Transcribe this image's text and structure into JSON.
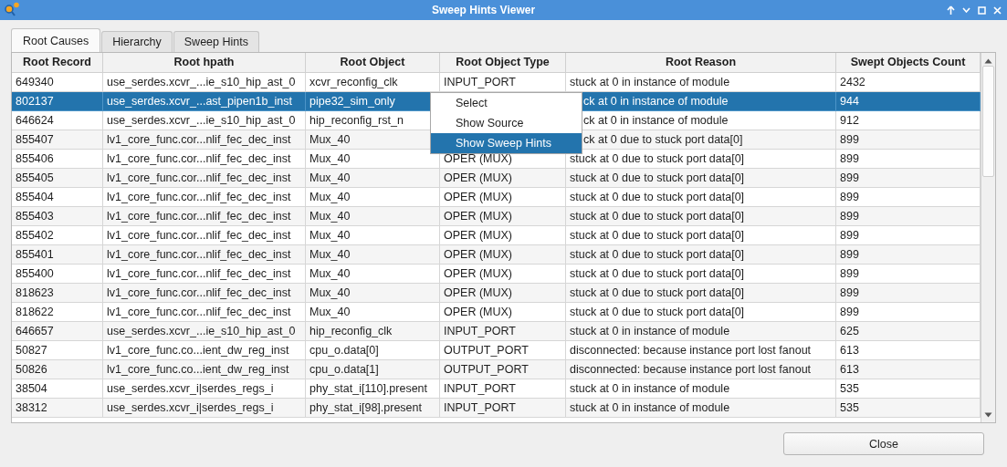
{
  "window": {
    "title": "Sweep Hints Viewer"
  },
  "tabs": [
    {
      "label": "Root Causes",
      "selected": true
    },
    {
      "label": "Hierarchy",
      "selected": false
    },
    {
      "label": "Sweep Hints",
      "selected": false
    }
  ],
  "table": {
    "columns": [
      "Root Record",
      "Root hpath",
      "Root Object",
      "Root Object Type",
      "Root Reason",
      "Swept Objects Count"
    ],
    "rows": [
      {
        "selected": false,
        "cells": [
          "649340",
          "use_serdes.xcvr_...ie_s10_hip_ast_0",
          "xcvr_reconfig_clk",
          "INPUT_PORT",
          "stuck at 0 in instance of module",
          "2432"
        ]
      },
      {
        "selected": true,
        "cells": [
          "802137",
          "use_serdes.xcvr_...ast_pipen1b_inst",
          "pipe32_sim_only",
          null,
          "ck at 0 in instance of module",
          "944"
        ]
      },
      {
        "selected": false,
        "cells": [
          "646624",
          "use_serdes.xcvr_...ie_s10_hip_ast_0",
          "hip_reconfig_rst_n",
          null,
          "ck at 0 in instance of module",
          "912"
        ]
      },
      {
        "selected": false,
        "cells": [
          "855407",
          "lv1_core_func.cor...nlif_fec_dec_inst",
          "Mux_40",
          null,
          "ck at 0 due to stuck port data[0]",
          "899"
        ]
      },
      {
        "selected": false,
        "cells": [
          "855406",
          "lv1_core_func.cor...nlif_fec_dec_inst",
          "Mux_40",
          "OPER (MUX)",
          "stuck at 0 due to stuck port data[0]",
          "899"
        ]
      },
      {
        "selected": false,
        "cells": [
          "855405",
          "lv1_core_func.cor...nlif_fec_dec_inst",
          "Mux_40",
          "OPER (MUX)",
          "stuck at 0 due to stuck port data[0]",
          "899"
        ]
      },
      {
        "selected": false,
        "cells": [
          "855404",
          "lv1_core_func.cor...nlif_fec_dec_inst",
          "Mux_40",
          "OPER (MUX)",
          "stuck at 0 due to stuck port data[0]",
          "899"
        ]
      },
      {
        "selected": false,
        "cells": [
          "855403",
          "lv1_core_func.cor...nlif_fec_dec_inst",
          "Mux_40",
          "OPER (MUX)",
          "stuck at 0 due to stuck port data[0]",
          "899"
        ]
      },
      {
        "selected": false,
        "cells": [
          "855402",
          "lv1_core_func.cor...nlif_fec_dec_inst",
          "Mux_40",
          "OPER (MUX)",
          "stuck at 0 due to stuck port data[0]",
          "899"
        ]
      },
      {
        "selected": false,
        "cells": [
          "855401",
          "lv1_core_func.cor...nlif_fec_dec_inst",
          "Mux_40",
          "OPER (MUX)",
          "stuck at 0 due to stuck port data[0]",
          "899"
        ]
      },
      {
        "selected": false,
        "cells": [
          "855400",
          "lv1_core_func.cor...nlif_fec_dec_inst",
          "Mux_40",
          "OPER (MUX)",
          "stuck at 0 due to stuck port data[0]",
          "899"
        ]
      },
      {
        "selected": false,
        "cells": [
          "818623",
          "lv1_core_func.cor...nlif_fec_dec_inst",
          "Mux_40",
          "OPER (MUX)",
          "stuck at 0 due to stuck port data[0]",
          "899"
        ]
      },
      {
        "selected": false,
        "cells": [
          "818622",
          "lv1_core_func.cor...nlif_fec_dec_inst",
          "Mux_40",
          "OPER (MUX)",
          "stuck at 0 due to stuck port data[0]",
          "899"
        ]
      },
      {
        "selected": false,
        "cells": [
          "646657",
          "use_serdes.xcvr_...ie_s10_hip_ast_0",
          "hip_reconfig_clk",
          "INPUT_PORT",
          "stuck at 0 in instance of module",
          "625"
        ]
      },
      {
        "selected": false,
        "cells": [
          "50827",
          "lv1_core_func.co...ient_dw_reg_inst",
          "cpu_o.data[0]",
          "OUTPUT_PORT",
          "disconnected: because instance port lost fanout",
          "613"
        ]
      },
      {
        "selected": false,
        "cells": [
          "50826",
          "lv1_core_func.co...ient_dw_reg_inst",
          "cpu_o.data[1]",
          "OUTPUT_PORT",
          "disconnected: because instance port lost fanout",
          "613"
        ]
      },
      {
        "selected": false,
        "cells": [
          "38504",
          "use_serdes.xcvr_i|serdes_regs_i",
          "phy_stat_i[110].present",
          "INPUT_PORT",
          "stuck at 0 in instance of module",
          "535"
        ]
      },
      {
        "selected": false,
        "cells": [
          "38312",
          "use_serdes.xcvr_i|serdes_regs_i",
          "phy_stat_i[98].present",
          "INPUT_PORT",
          "stuck at 0 in instance of module",
          "535"
        ]
      }
    ]
  },
  "context_menu": {
    "items": [
      {
        "label": "Select",
        "selected": false
      },
      {
        "label": "Show Source",
        "selected": false
      },
      {
        "label": "Show Sweep Hints",
        "selected": true
      }
    ]
  },
  "buttons": [
    "Close"
  ]
}
